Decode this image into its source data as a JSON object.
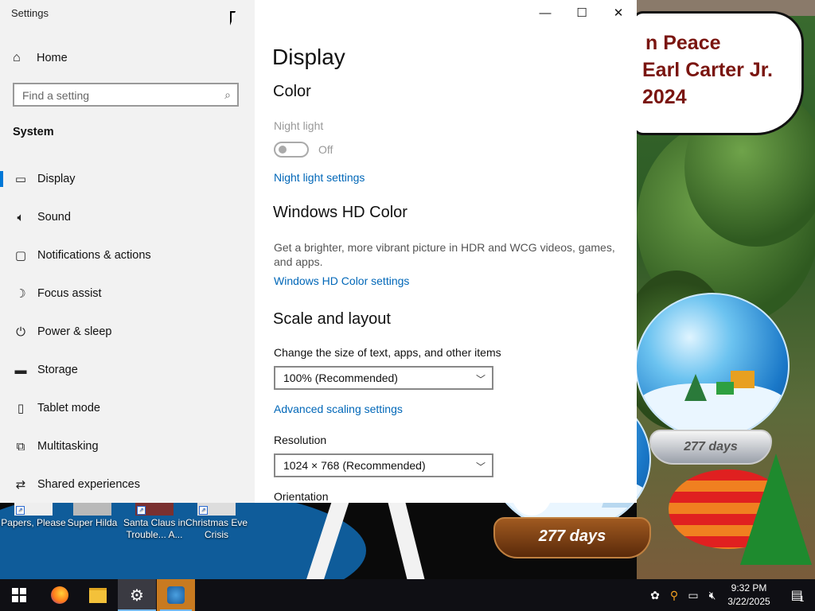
{
  "window": {
    "title": "Settings",
    "minimize_glyph": "—",
    "maximize_glyph": "☐",
    "close_glyph": "✕"
  },
  "sidebar": {
    "home_label": "Home",
    "search_placeholder": "Find a setting",
    "section": "System",
    "items": [
      {
        "label": "Display",
        "icon": "monitor-icon",
        "active": true
      },
      {
        "label": "Sound",
        "icon": "speaker-icon"
      },
      {
        "label": "Notifications & actions",
        "icon": "notification-icon"
      },
      {
        "label": "Focus assist",
        "icon": "moon-icon"
      },
      {
        "label": "Power & sleep",
        "icon": "power-icon"
      },
      {
        "label": "Storage",
        "icon": "storage-icon"
      },
      {
        "label": "Tablet mode",
        "icon": "tablet-icon"
      },
      {
        "label": "Multitasking",
        "icon": "multitask-icon"
      },
      {
        "label": "Shared experiences",
        "icon": "shared-icon"
      }
    ]
  },
  "content": {
    "title": "Display",
    "color_heading": "Color",
    "night_light_label": "Night light",
    "night_light_state": "Off",
    "night_light_link": "Night light settings",
    "hd_color_heading": "Windows HD Color",
    "hd_color_desc": "Get a brighter, more vibrant picture in HDR and WCG videos, games, and apps.",
    "hd_color_link": "Windows HD Color settings",
    "scale_heading": "Scale and layout",
    "scale_label": "Change the size of text, apps, and other items",
    "scale_value": "100% (Recommended)",
    "advanced_scaling_link": "Advanced scaling settings",
    "resolution_label": "Resolution",
    "resolution_value": "1024 × 768 (Recommended)",
    "orientation_label": "Orientation"
  },
  "desktop": {
    "icons": [
      {
        "label": "Papers, Please"
      },
      {
        "label": "Super Hilda"
      },
      {
        "label": "Santa Claus in Trouble... A..."
      },
      {
        "label": "Christmas Eve Crisis"
      }
    ],
    "wallpaper_text": [
      "n Peace",
      "Earl Carter Jr.",
      "2024"
    ],
    "globe_large_text": "277 days",
    "globe_small_text": "277 days"
  },
  "taskbar": {
    "time": "9:32 PM",
    "date": "3/22/2025",
    "notification_count": "1",
    "accent": "#76b9ed"
  }
}
